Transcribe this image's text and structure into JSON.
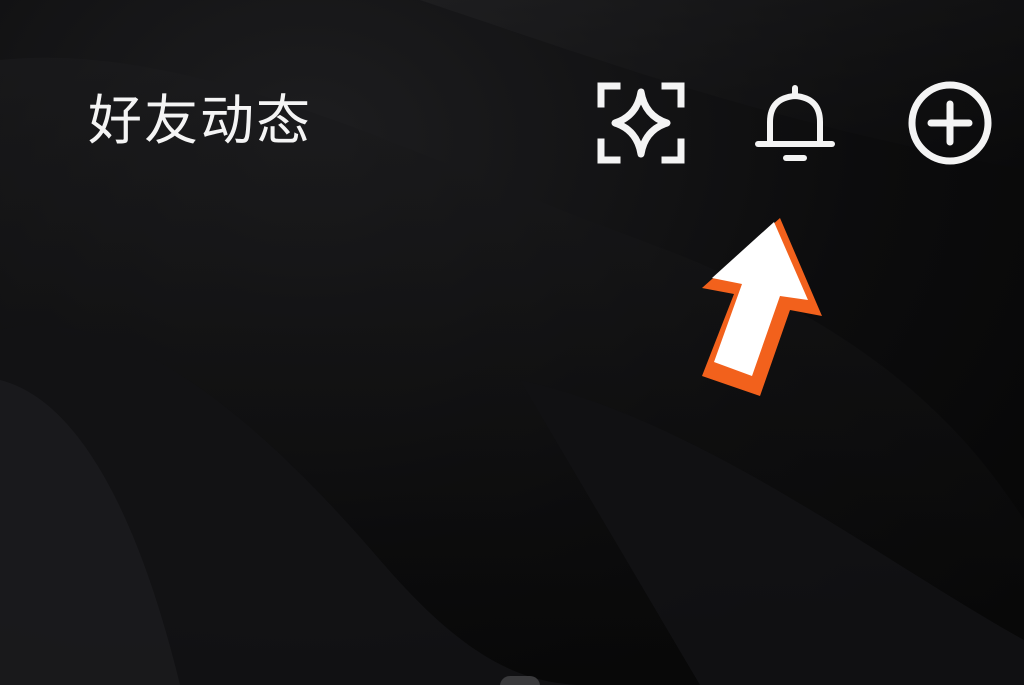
{
  "header": {
    "title": "好友动态"
  },
  "icons": {
    "spark": "sparkle-frame-icon",
    "bell": "bell-icon",
    "add": "plus-circle-icon"
  },
  "overlay": {
    "arrow_icon": "pointer-arrow-icon",
    "arrow_color": "#f2611c"
  },
  "colors": {
    "background": "#0b0b0c",
    "foreground": "#f4f4f4",
    "accent": "#f2611c"
  }
}
